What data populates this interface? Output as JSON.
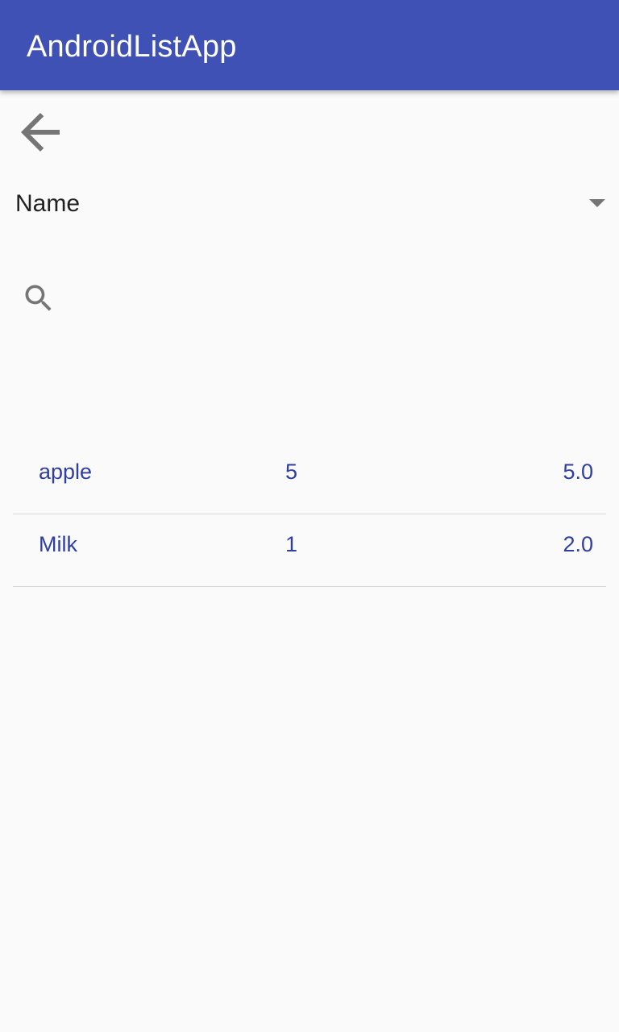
{
  "app_bar": {
    "title": "AndroidListApp",
    "color": "#3f51b5"
  },
  "toolbar": {
    "back_icon": "arrow-back-icon"
  },
  "sort_spinner": {
    "selected": "Name",
    "icon": "dropdown-arrow-icon"
  },
  "search": {
    "icon": "search-icon"
  },
  "items": [
    {
      "name": "apple",
      "quantity": "5",
      "price": "5.0"
    },
    {
      "name": "Milk",
      "quantity": "1",
      "price": "2.0"
    }
  ],
  "colors": {
    "primary": "#3f51b5",
    "list_text": "#303f9f",
    "icon_grey": "#757575",
    "divider": "#d6d6d6",
    "background": "#fafafa"
  }
}
